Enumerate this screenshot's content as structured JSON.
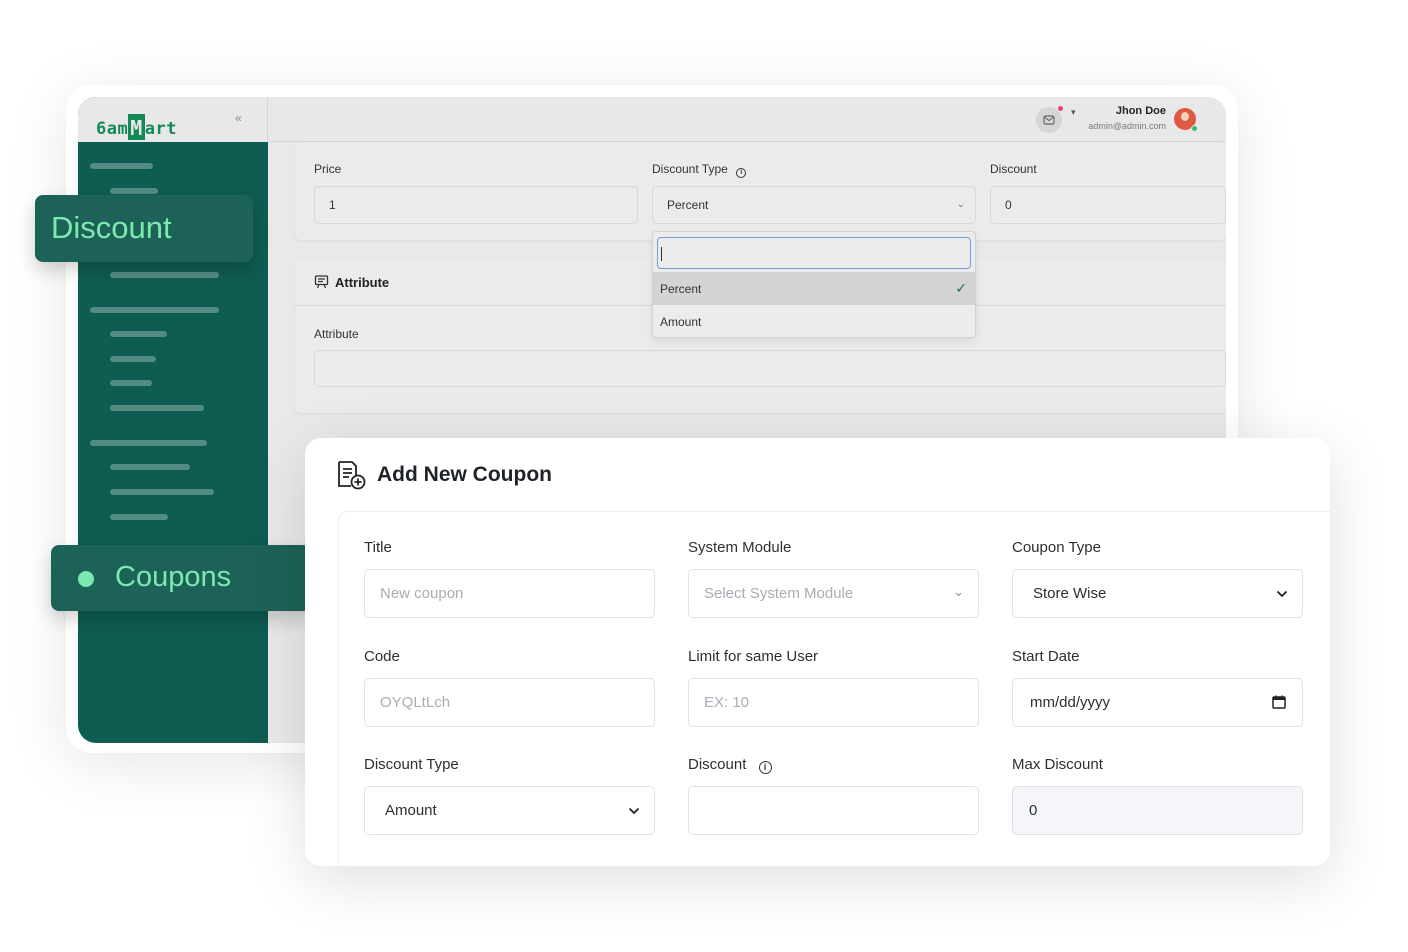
{
  "brand": {
    "logo_prefix": "6am",
    "logo_m": "M",
    "logo_suffix": "art",
    "collapse_icon": "«"
  },
  "header": {
    "user_name": "Jhon Doe",
    "user_email": "admin@admin.com",
    "caret": "▾"
  },
  "product_form": {
    "price_label": "Price",
    "price_value": "1",
    "discount_type_label": "Discount Type",
    "discount_type_value": "Percent",
    "discount_label": "Discount",
    "discount_value": "0",
    "attribute_section_title": "Attribute",
    "attribute_label": "Attribute",
    "dropdown_options": [
      {
        "label": "Percent",
        "selected": true
      },
      {
        "label": "Amount",
        "selected": false
      }
    ]
  },
  "badges": {
    "discount": "Discount",
    "coupons": "Coupons"
  },
  "coupon_form": {
    "title": "Add New Coupon",
    "fields": {
      "title_label": "Title",
      "title_placeholder": "New coupon",
      "system_module_label": "System Module",
      "system_module_placeholder": "Select System Module",
      "coupon_type_label": "Coupon Type",
      "coupon_type_value": "Store Wise",
      "code_label": "Code",
      "code_placeholder": "OYQLtLch",
      "limit_label": "Limit for same User",
      "limit_placeholder": "EX: 10",
      "start_date_label": "Start Date",
      "start_date_placeholder": "mm/dd/yyyy",
      "discount_type_label": "Discount Type",
      "discount_type_value": "Amount",
      "discount_label": "Discount",
      "discount_value": "",
      "max_discount_label": "Max Discount",
      "max_discount_value": "0"
    }
  },
  "colors": {
    "sidebar": "#0f5c52",
    "badge_bg": "#1d6257",
    "badge_text": "#7ee8b2",
    "brand_green": "#138a55"
  }
}
